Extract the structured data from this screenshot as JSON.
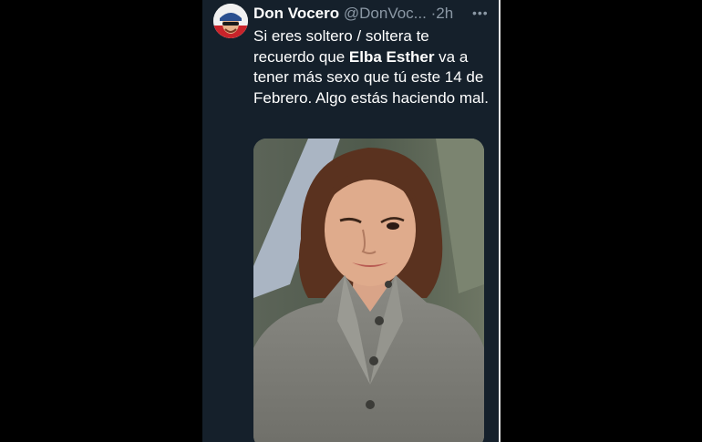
{
  "tweet": {
    "display_name": "Don Vocero",
    "handle": "@DonVoc...",
    "separator": "·",
    "time": "2h",
    "more_icon": "more-horizontal-icon",
    "text_parts": [
      "Si eres soltero / soltera te recuerdo que ",
      "Elba Esther",
      " va a tener más sexo que tú este 14 de Febrero. Algo estás haciendo mal."
    ]
  },
  "colors": {
    "background": "#15202b",
    "text": "#ffffff",
    "secondary_text": "#8b98a5"
  }
}
